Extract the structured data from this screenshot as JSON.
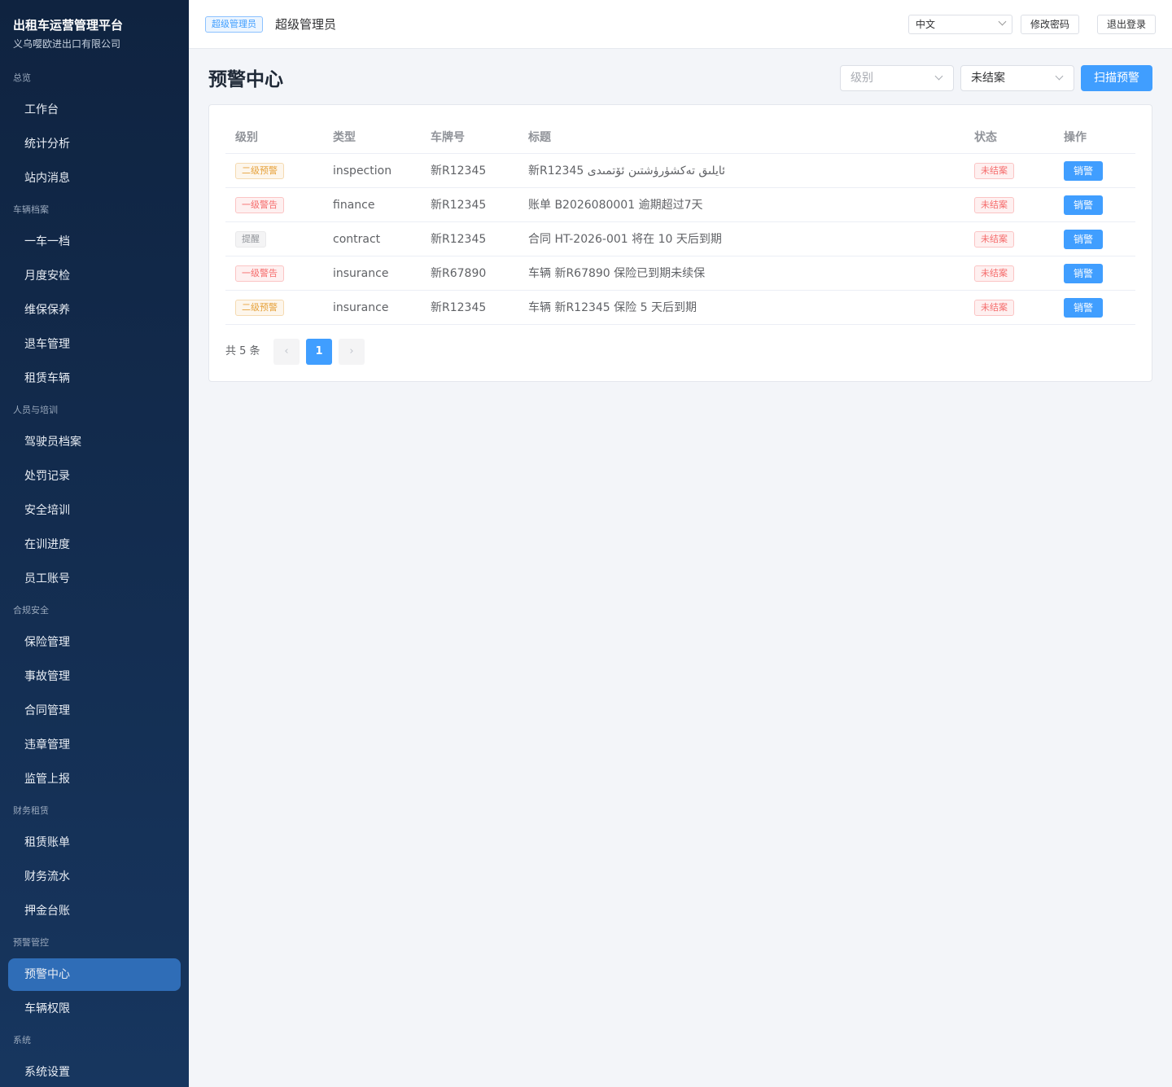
{
  "sidebar": {
    "brand_title": "出租车运营管理平台",
    "brand_sub": "义乌嘤欧进出口有限公司",
    "groups": [
      {
        "title": "总览",
        "items": [
          "工作台",
          "统计分析",
          "站内消息"
        ]
      },
      {
        "title": "车辆档案",
        "items": [
          "一车一档",
          "月度安检",
          "维保保养",
          "退车管理",
          "租赁车辆"
        ]
      },
      {
        "title": "人员与培训",
        "items": [
          "驾驶员档案",
          "处罚记录",
          "安全培训",
          "在训进度",
          "员工账号"
        ]
      },
      {
        "title": "合规安全",
        "items": [
          "保险管理",
          "事故管理",
          "合同管理",
          "违章管理",
          "监管上报"
        ]
      },
      {
        "title": "财务租赁",
        "items": [
          "租赁账单",
          "财务流水",
          "押金台账"
        ]
      },
      {
        "title": "预警管控",
        "items": [
          "预警中心",
          "车辆权限"
        ]
      },
      {
        "title": "系统",
        "items": [
          "系统设置"
        ]
      }
    ],
    "active_item": "预警中心"
  },
  "header": {
    "role_tag": "超级管理员",
    "user_name": "超级管理员",
    "language": "中文",
    "change_password": "修改密码",
    "logout": "退出登录"
  },
  "main": {
    "title": "预警中心",
    "filter_level_placeholder": "级别",
    "filter_status_value": "未结案",
    "scan_button": "扫描预警",
    "table": {
      "columns": [
        "级别",
        "类型",
        "车牌号",
        "标题",
        "状态",
        "操作"
      ],
      "rows": [
        {
          "level": "二级预警",
          "level_color": "#e6a23c",
          "type": "inspection",
          "plate": "新R12345",
          "title": "新R12345 ئايلىق تەكشۈرۈشتىن ئۆتمىدى",
          "status": "未结案",
          "action": "销警"
        },
        {
          "level": "一级警告",
          "level_color": "#f56c6c",
          "type": "finance",
          "plate": "新R12345",
          "title": "账单 B2026080001 逾期超过7天",
          "status": "未结案",
          "action": "销警"
        },
        {
          "level": "提醒",
          "level_color": "#909399",
          "type": "contract",
          "plate": "新R12345",
          "title": "合同 HT-2026-001 将在 10 天后到期",
          "status": "未结案",
          "action": "销警"
        },
        {
          "level": "一级警告",
          "level_color": "#f56c6c",
          "type": "insurance",
          "plate": "新R67890",
          "title": "车辆 新R67890 保险已到期未续保",
          "status": "未结案",
          "action": "销警"
        },
        {
          "level": "二级预警",
          "level_color": "#e6a23c",
          "type": "insurance",
          "plate": "新R12345",
          "title": "车辆 新R12345 保险 5 天后到期",
          "status": "未结案",
          "action": "销警"
        }
      ]
    },
    "pagination": {
      "total_text": "共 5 条",
      "current_page": "1",
      "prev_icon": "chevron-left-icon",
      "next_icon": "chevron-right-icon"
    }
  },
  "colors": {
    "primary": "#409eff",
    "sidebar_bg": "#0f2340",
    "active_nav": "#2f6db7",
    "warning": "#e6a23c",
    "danger": "#f56c6c"
  }
}
